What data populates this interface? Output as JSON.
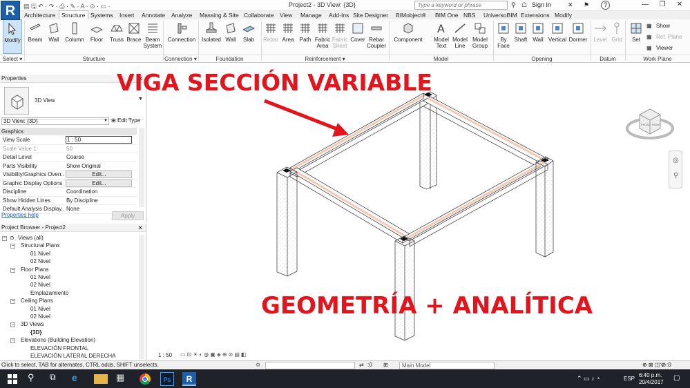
{
  "app": {
    "logo": "R",
    "doc_title": "Project2 - 3D View: {3D}",
    "search_placeholder": "Type a keyword or phrase",
    "sign_in": "Sign In",
    "qat_glyphs": "▤ 🖫 ↶ · ↷ · ⎙ · ✎ · A · ⊙ · ▭ ·"
  },
  "tabs": [
    "Architecture",
    "Structure",
    "Systems",
    "Insert",
    "Annotate",
    "Analyze",
    "Massing & Site",
    "Collaborate",
    "View",
    "Manage",
    "Add-Ins",
    "Site Designer",
    "BIMobject®",
    "BIM One",
    "NBS",
    "UniversoBIM",
    "Extensions",
    "Modify"
  ],
  "active_tab": "Structure",
  "ribbon": {
    "modify": "Modify",
    "structure": [
      "Beam",
      "Wall",
      "Column",
      "Floor",
      "Truss",
      "Brace",
      "Beam System"
    ],
    "connection": [
      "Connection"
    ],
    "foundation": [
      "Isolated",
      "Wall",
      "Slab"
    ],
    "reinforcement": [
      "Rebar",
      "Area",
      "Path",
      "Fabric Area",
      "Fabric Sheet",
      "Cover",
      "Rebar Coupler"
    ],
    "model": [
      "Component",
      "Model Text",
      "Model Line",
      "Model Group"
    ],
    "opening": [
      "By Face",
      "Shaft",
      "Wall",
      "Vertical",
      "Dormer"
    ],
    "datum": [
      "Level",
      "Grid"
    ],
    "work_plane": [
      "Set",
      "Show",
      "Ref. Plane",
      "Viewer"
    ],
    "groups": [
      "Select ▾",
      "Structure",
      "Connection ▾",
      "Foundation",
      "Reinforcement ▾",
      "Model",
      "Opening",
      "Datum",
      "Work Plane"
    ]
  },
  "properties": {
    "title": "Properties",
    "type_name": "3D View",
    "view_selector": "3D View: {3D}",
    "edit_type": "Edit Type",
    "category": "Graphics",
    "rows": [
      {
        "name": "View Scale",
        "value": "1 : 50"
      },
      {
        "name": "Scale Value    1:",
        "value": "50"
      },
      {
        "name": "Detail Level",
        "value": "Coarse"
      },
      {
        "name": "Parts Visibility",
        "value": "Show Original"
      },
      {
        "name": "Visibility/Graphics Overr...",
        "value": "Edit..."
      },
      {
        "name": "Graphic Display Options",
        "value": "Edit..."
      },
      {
        "name": "Discipline",
        "value": "Coordination"
      },
      {
        "name": "Show Hidden Lines",
        "value": "By Discipline"
      },
      {
        "name": "Default Analysis Display...",
        "value": "None"
      }
    ],
    "help": "Properties help",
    "apply": "Apply"
  },
  "browser": {
    "title": "Project Browser - Project2",
    "nodes": [
      {
        "label": "Views (all)",
        "level": 0
      },
      {
        "label": "Structural Plans",
        "level": 1
      },
      {
        "label": "01 Nivel",
        "level": 2
      },
      {
        "label": "02 Nivel",
        "level": 2
      },
      {
        "label": "Floor Plans",
        "level": 1
      },
      {
        "label": "01 Nivel",
        "level": 2
      },
      {
        "label": "02 Nivel",
        "level": 2
      },
      {
        "label": "Emplazamiento",
        "level": 2
      },
      {
        "label": "Ceiling Plans",
        "level": 1
      },
      {
        "label": "01 Nivel",
        "level": 2
      },
      {
        "label": "02 Nivel",
        "level": 2
      },
      {
        "label": "3D Views",
        "level": 1
      },
      {
        "label": "{3D}",
        "level": 2
      },
      {
        "label": "Elevations (Building Elevation)",
        "level": 1
      },
      {
        "label": "ELEVACIÓN FRONTAL",
        "level": 2
      },
      {
        "label": "ELEVACIÓN LATERAL DERECHA",
        "level": 2
      }
    ]
  },
  "annotations": {
    "title": "VIGA SECCIÓN VARIABLE",
    "subtitle": "GEOMETRÍA + ANALÍTICA"
  },
  "viewcube": {
    "front": "FRONT",
    "right": "RIGHT"
  },
  "viewbar": {
    "scale": "1 : 50"
  },
  "status": {
    "message": "Click to select, TAB for alternates, CTRL adds, SHIFT unselects.",
    "model": "Main Model",
    "filter_count": ":0"
  },
  "taskbar": {
    "time": "6:40 p.m.",
    "date": "20/4/2017",
    "lang": "ESP"
  },
  "colors": {
    "accent": "#1d5ea8",
    "annotation": "#e3141c",
    "beam_highlight": "#f3c9b4"
  }
}
